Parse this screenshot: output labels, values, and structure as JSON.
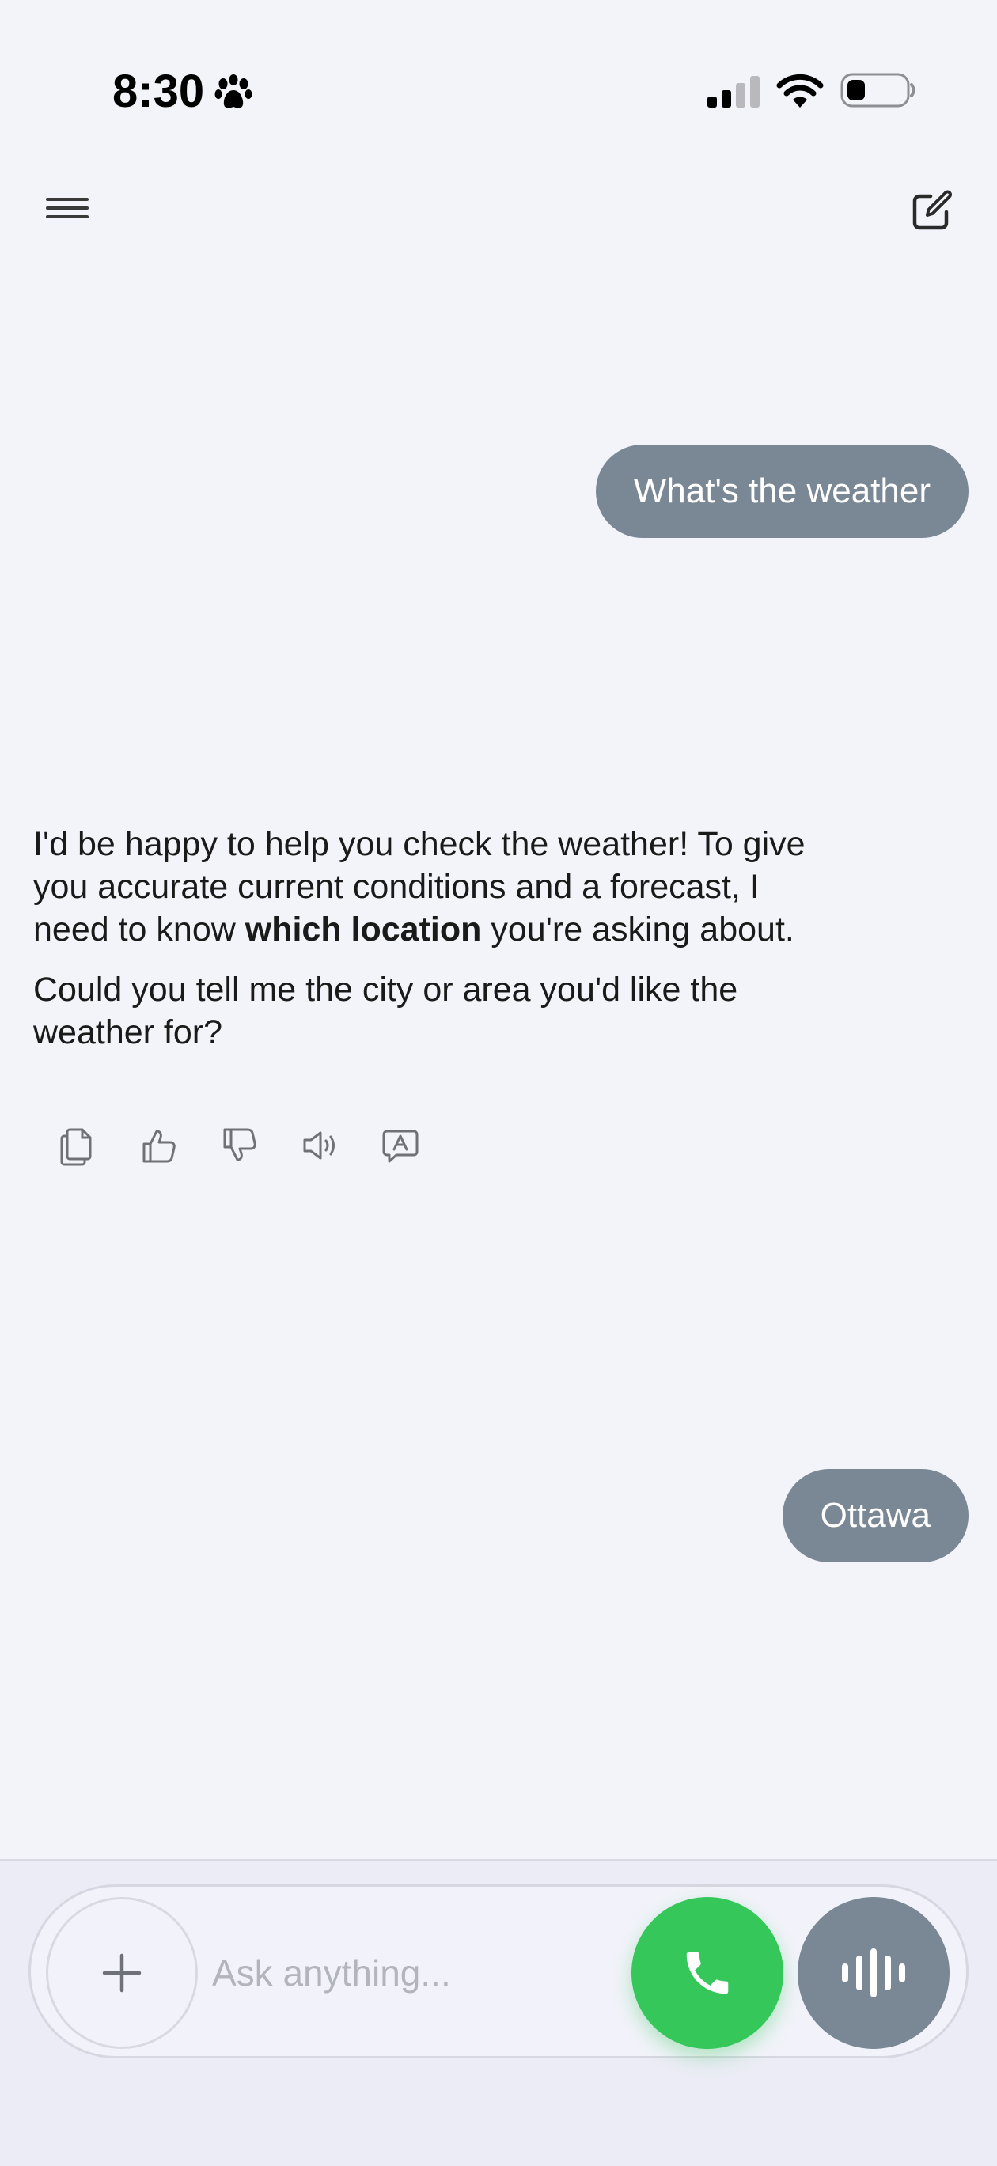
{
  "status_bar": {
    "time": "8:30"
  },
  "header": {
    "menu_icon": "hamburger-menu-icon",
    "new_chat_icon": "compose-icon"
  },
  "messages": [
    {
      "role": "user",
      "text": "What's the weather"
    },
    {
      "role": "assistant",
      "p1_pre": "I'd be happy to help you check the weather! To give you accurate current conditions and a forecast, I need to know ",
      "p1_bold": "which location",
      "p1_post": " you're asking about.",
      "p2": "Could you tell me the city or area you'd like the weather for?"
    },
    {
      "role": "user",
      "text": "Ottawa"
    }
  ],
  "message_actions": [
    "copy-icon",
    "thumbs-up-icon",
    "thumbs-down-icon",
    "speaker-icon",
    "translate-icon"
  ],
  "composer": {
    "placeholder": "Ask anything...",
    "value": ""
  },
  "colors": {
    "background": "#f3f4f9",
    "user_bubble": "#7a8794",
    "call_button": "#35c75a",
    "voice_button": "#7a8794"
  }
}
